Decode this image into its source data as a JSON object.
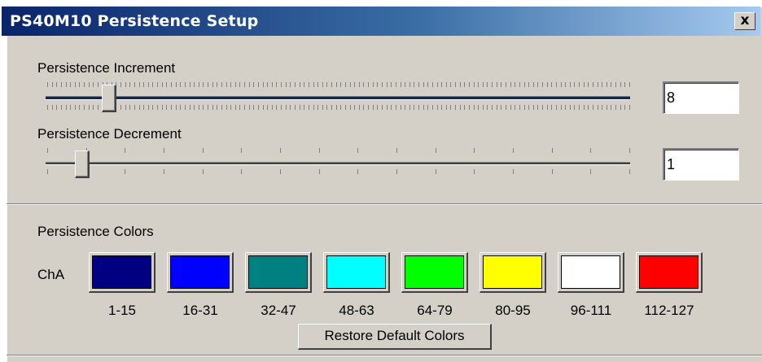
{
  "window": {
    "title": "PS40M10 Persistence Setup",
    "close_glyph": "x"
  },
  "increment": {
    "label": "Persistence Increment",
    "value": "8",
    "slider_value": 8,
    "slider_min": 0,
    "slider_max": 127
  },
  "decrement": {
    "label": "Persistence Decrement",
    "value": "1",
    "slider_value": 1,
    "slider_min": 0,
    "slider_max": 15
  },
  "colors": {
    "group_label": "Persistence Colors",
    "channel_label": "ChA",
    "swatches": [
      {
        "range": "1-15",
        "color": "#000080"
      },
      {
        "range": "16-31",
        "color": "#0000ff"
      },
      {
        "range": "32-47",
        "color": "#008080"
      },
      {
        "range": "48-63",
        "color": "#00ffff"
      },
      {
        "range": "64-79",
        "color": "#00ff00"
      },
      {
        "range": "80-95",
        "color": "#ffff00"
      },
      {
        "range": "96-111",
        "color": "#ffffff"
      },
      {
        "range": "112-127",
        "color": "#ff0000"
      }
    ],
    "restore_label": "Restore Default Colors"
  }
}
